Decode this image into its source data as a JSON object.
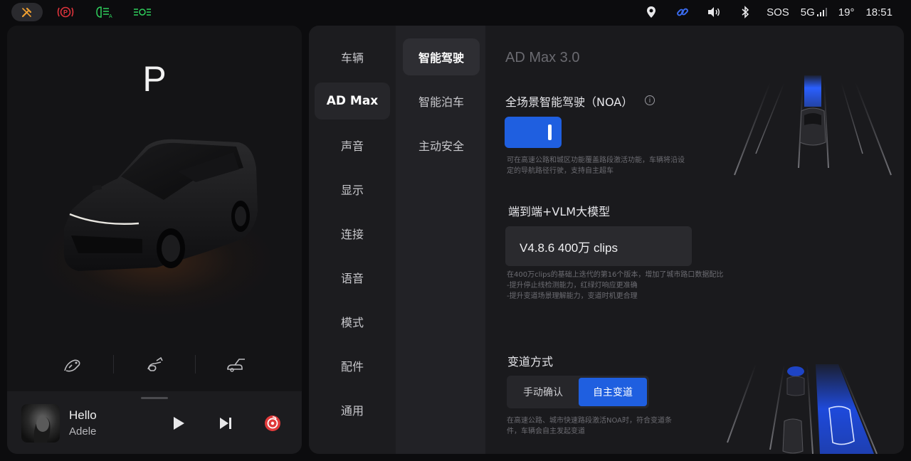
{
  "status_bar": {
    "left_icons": [
      "wrench-icon",
      "parking-brake-icon",
      "auto-high-beam-icon",
      "position-lights-icon"
    ],
    "right_icons": [
      "location-pin-icon",
      "link-icon",
      "volume-icon",
      "bluetooth-icon"
    ],
    "sos": "SOS",
    "network": "5G",
    "temperature": "19°",
    "time": "18:51",
    "colors": {
      "brake": "#e0343c",
      "lights": "#2fcf5c",
      "link": "#3a6cf0",
      "wrench": "#f0a030"
    }
  },
  "left_panel": {
    "gear": "P",
    "controls": [
      "charge-port-icon",
      "frunk-icon",
      "tailgate-icon"
    ],
    "media": {
      "song": "Hello",
      "artist": "Adele",
      "buttons": [
        "play-icon",
        "next-track-icon",
        "music-app-icon"
      ]
    }
  },
  "nav_primary": {
    "items": [
      "车辆",
      "AD Max",
      "声音",
      "显示",
      "连接",
      "语音",
      "模式",
      "配件",
      "通用"
    ],
    "selected": "AD Max"
  },
  "nav_secondary": {
    "items": [
      "智能驾驶",
      "智能泊车",
      "主动安全"
    ],
    "selected": "智能驾驶"
  },
  "content": {
    "section_title": "AD Max 3.0",
    "noa": {
      "label": "全场景智能驾驶（NOA）",
      "enabled": true,
      "desc_line1": "可在高速公路和城区功能覆盖路段激活功能，车辆将沿设",
      "desc_line2": "定的导航路径行驶，支持自主超车"
    },
    "model": {
      "label": "端到端+VLM大模型",
      "version": "V4.8.6  400万 clips",
      "desc_line1": "在400万clips的基础上迭代的第16个版本，增加了城市路口数据配比",
      "desc_line2": "-提升停止线检测能力，红绿灯响应更准确",
      "desc_line3": "-提升变道场景理解能力，变道时机更合理"
    },
    "lane_change": {
      "label": "变道方式",
      "options": [
        "手动确认",
        "自主变道"
      ],
      "selected": "自主变道",
      "desc_line1": "在高速公路、城市快速路段激活NOA时，符合变道条",
      "desc_line2": "件，车辆会自主发起变道"
    },
    "accent": "#1f5fe0"
  }
}
